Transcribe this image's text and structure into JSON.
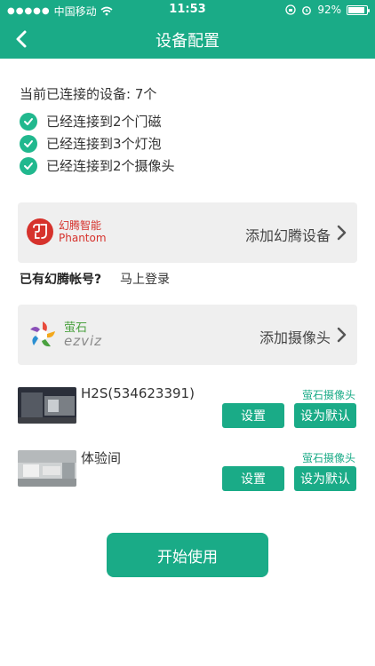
{
  "status_bar": {
    "carrier": "中国移动",
    "time": "11:53",
    "battery_text": "92%",
    "battery_level": 0.92
  },
  "navbar": {
    "title": "设备配置",
    "back_icon": "chevron-left-icon"
  },
  "summary": {
    "connected_label": "当前已连接的设备: 7个",
    "items": [
      {
        "label": "已经连接到2个门磁"
      },
      {
        "label": "已经连接到3个灯泡"
      },
      {
        "label": "已经连接到2个摄像头"
      }
    ]
  },
  "phantom_card": {
    "logo_cn": "幻腾智能",
    "logo_en": "Phantom",
    "action_label": "添加幻腾设备"
  },
  "login": {
    "question": "已有幻腾帐号?",
    "link": "马上登录"
  },
  "ezviz_card": {
    "logo_cn": "萤石",
    "logo_en": "ezviz",
    "action_label": "添加摄像头"
  },
  "devices": [
    {
      "name": "H2S(534623391)",
      "type": "萤石摄像头",
      "set_label": "设置",
      "default_label": "设为默认"
    },
    {
      "name": "体验间",
      "type": "萤石摄像头",
      "set_label": "设置",
      "default_label": "设为默认"
    }
  ],
  "start_button": {
    "label": "开始使用"
  },
  "colors": {
    "accent": "#1aab87",
    "check": "#21b88e",
    "phantom_red": "#d6322c",
    "card_bg": "#efefef"
  }
}
